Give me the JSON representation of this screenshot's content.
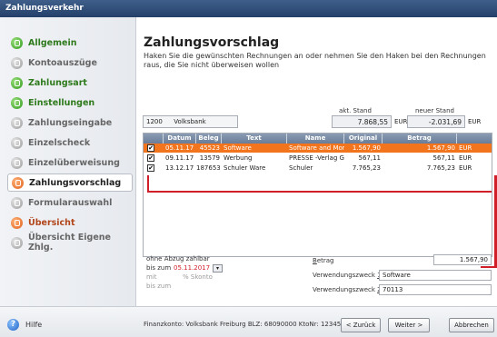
{
  "window": {
    "title": "Zahlungsverkehr"
  },
  "sidebar": {
    "items": [
      {
        "label": "Allgemein",
        "state": "done"
      },
      {
        "label": "Kontoauszüge",
        "state": "inactive"
      },
      {
        "label": "Zahlungsart",
        "state": "done"
      },
      {
        "label": "Einstellungen",
        "state": "done"
      },
      {
        "label": "Zahlungseingabe",
        "state": "inactive"
      },
      {
        "label": "Einzelscheck",
        "state": "inactive"
      },
      {
        "label": "Einzelüberweisung",
        "state": "inactive"
      },
      {
        "label": "Zahlungsvorschlag",
        "state": "active"
      },
      {
        "label": "Formularauswahl",
        "state": "inactive"
      },
      {
        "label": "Übersicht",
        "state": "pending"
      },
      {
        "label": "Übersicht Eigene Zhlg.",
        "state": "inactive"
      }
    ]
  },
  "main": {
    "title": "Zahlungsvorschlag",
    "description": "Haken Sie die gewünschten Rechnungen an oder nehmen Sie den Haken bei den Rechnungen raus, die Sie nicht überweisen wollen",
    "account": {
      "number": "1200",
      "bank": "Volksbank",
      "current_label": "akt. Stand",
      "current_value": "7.868,55",
      "new_label": "neuer Stand",
      "new_value": "-2.031,69",
      "currency": "EUR"
    },
    "table": {
      "columns": [
        "Datum",
        "Beleg",
        "Text",
        "Name",
        "Original",
        "Betrag"
      ],
      "rows": [
        {
          "checked": "✔",
          "date": "05.11.17",
          "beleg": "45523",
          "text": "Software",
          "name": "Software and More",
          "original": "1.567,90",
          "betrag": "1.567,90",
          "currency": "EUR",
          "selected": true
        },
        {
          "checked": "✔",
          "date": "09.11.17",
          "beleg": "13579",
          "text": "Werbung",
          "name": "PRESSE -Verlag Gml",
          "original": "567,11",
          "betrag": "567,11",
          "currency": "EUR",
          "selected": false
        },
        {
          "checked": "✔",
          "date": "13.12.17",
          "beleg": "187653",
          "text": "Schuler Ware",
          "name": "Schuler",
          "original": "7.765,23",
          "betrag": "7.765,23",
          "currency": "EUR",
          "selected": false
        }
      ]
    },
    "discount": {
      "no_deduction_label": "ohne Abzug zahlbar",
      "until_label": "bis zum",
      "until_date": "05.11.2017",
      "with_label": "mit",
      "skonto_label": "% Skonto",
      "until_label2": "bis zum"
    },
    "payment": {
      "amount_label_u": "B",
      "amount_label_rest": "etrag",
      "amount_value": "1.567,90",
      "purpose1_label": "Verwendungszweck ",
      "purpose1_num": "1",
      "purpose1_value": "Software",
      "purpose2_label": "Verwendungszweck ",
      "purpose2_num": "2",
      "purpose2_value": "70113"
    }
  },
  "footer": {
    "help_label": "Hilfe",
    "info": "Finanzkonto: Volksbank Freiburg  BLZ: 68090000  KtoNr: 12345",
    "back_label": "< Zurück",
    "next_label": "Weiter >",
    "cancel_label": "Abbrechen"
  },
  "colors": {
    "accent": "#f2741c",
    "highlight": "#d11f2a",
    "header": "#6a7d98"
  }
}
